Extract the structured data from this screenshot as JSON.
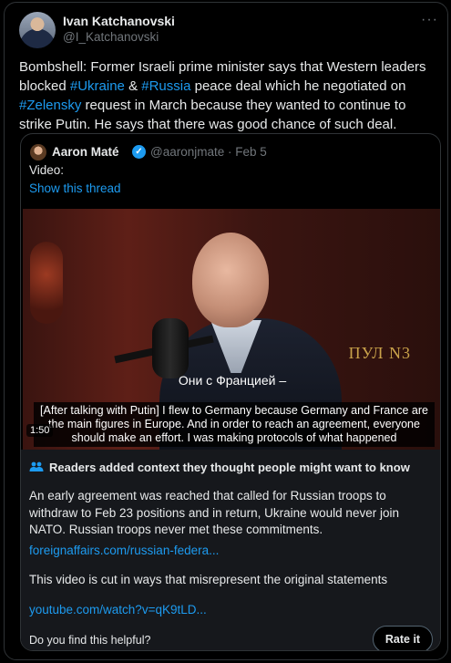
{
  "tweet": {
    "author_name": "Ivan Katchanovski",
    "author_handle": "@I_Katchanovski",
    "more_label": "···",
    "text_1": "Bombshell: Former Israeli prime minister says that Western leaders blocked ",
    "tag_1": "#Ukraine",
    "text_2": " & ",
    "tag_2": "#Russia",
    "text_3": " peace deal which he negotiated on ",
    "tag_3": "#Zelensky",
    "text_4": " request in March because they wanted to continue to strike Putin. He says that there was good chance of such deal."
  },
  "quote": {
    "author_name": "Aaron Maté",
    "verified_glyph": "✓",
    "author_handle": "@aaronjmate · Feb 5",
    "text": "Video:",
    "show_thread": "Show this thread",
    "video": {
      "watermark": "ПУЛ N3",
      "subtitle_ru": "Они с Францией –",
      "caption": "[After talking with Putin] I flew to Germany because Germany and France are the main figures in Europe. And in order to reach an agreement, everyone should make an effort. I was making protocols of what happened",
      "timestamp": "1:50"
    }
  },
  "community_notes": {
    "header": "Readers added context they thought people might want to know",
    "note_1": "An early agreement was reached that called for Russian troops to withdraw to Feb 23 positions and in return, Ukraine would never join NATO. Russian troops never met these commitments.",
    "link_1": "foreignaffairs.com/russian-federa...",
    "note_2": "This video is cut in ways that misrepresent the original statements",
    "link_2": "youtube.com/watch?v=qK9tLD...",
    "helpful_question": "Do you find this helpful?",
    "rate_label": "Rate it"
  }
}
